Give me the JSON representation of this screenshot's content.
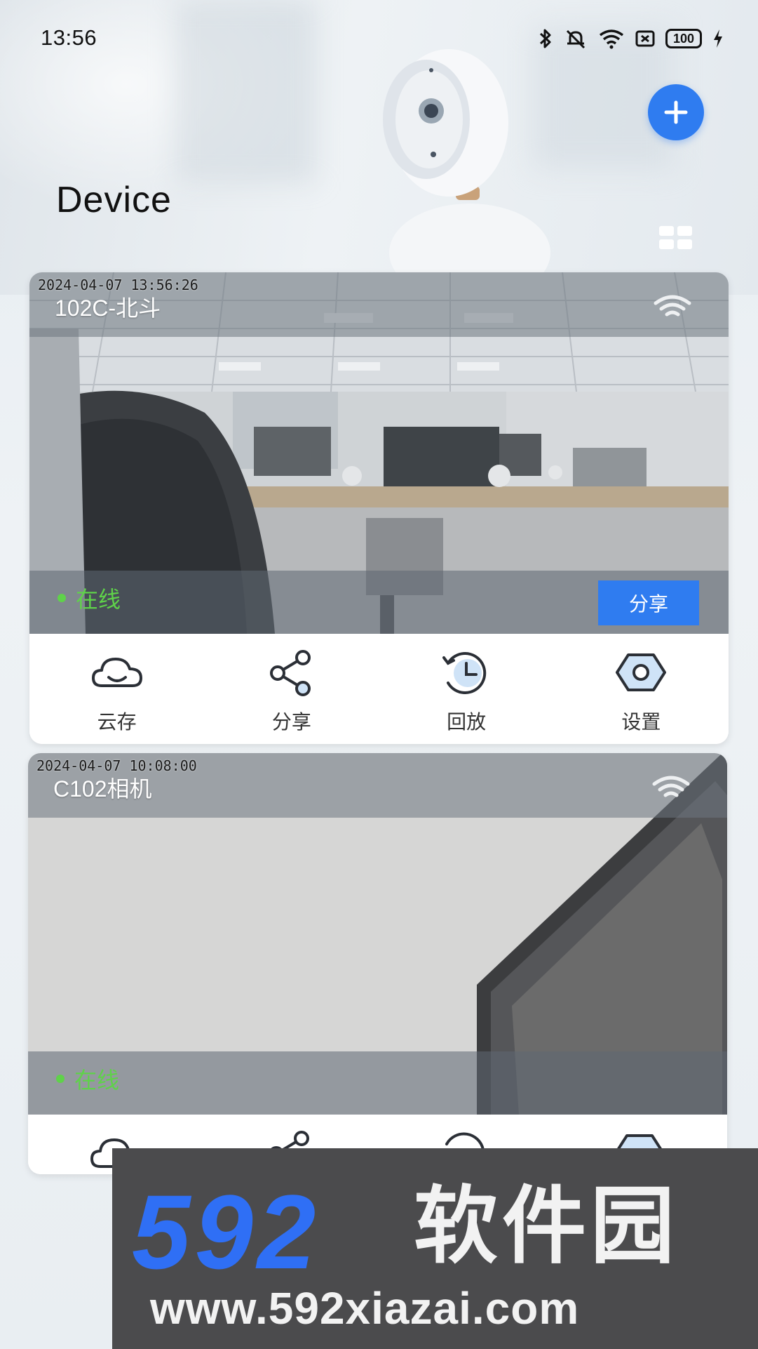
{
  "status_bar": {
    "time": "13:56",
    "battery": "100"
  },
  "header": {
    "title": "Device"
  },
  "colors": {
    "accent": "#2f7cf0",
    "online": "#5fd24a"
  },
  "devices": [
    {
      "timestamp": "2024-04-07 13:56:26",
      "name": "102C-北斗",
      "status": "在线",
      "share_label": "分享"
    },
    {
      "timestamp": "2024-04-07 10:08:00",
      "name": "C102相机",
      "status": "在线"
    }
  ],
  "actions": [
    {
      "label": "云存",
      "icon": "cloud-icon"
    },
    {
      "label": "分享",
      "icon": "share-icon"
    },
    {
      "label": "回放",
      "icon": "playback-icon"
    },
    {
      "label": "设置",
      "icon": "settings-icon"
    }
  ],
  "watermark": {
    "brand_digits": "592",
    "brand_text": "软件园",
    "url": "www.592xiazai.com"
  }
}
